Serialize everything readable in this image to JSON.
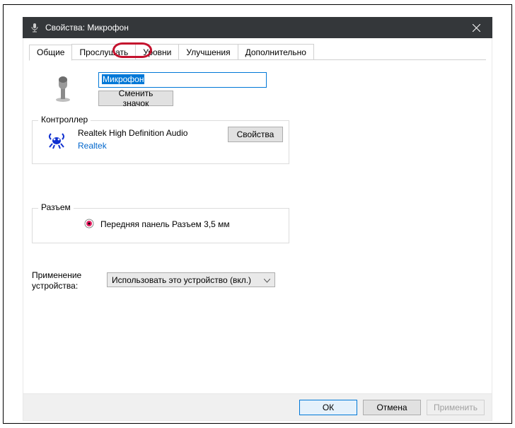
{
  "window": {
    "title": "Свойства: Микрофон"
  },
  "tabs": {
    "general": "Общие",
    "listen": "Прослушать",
    "levels": "Уровни",
    "enhancements": "Улучшения",
    "advanced": "Дополнительно"
  },
  "general": {
    "device_name": "Микрофон",
    "change_icon_btn": "Сменить значок"
  },
  "controller": {
    "legend": "Контроллер",
    "name": "Realtek High Definition Audio",
    "vendor": "Realtek",
    "props_btn": "Свойства"
  },
  "jack": {
    "legend": "Разъем",
    "text": "Передняя панель Разъем 3,5 мм",
    "color": "#e91e63"
  },
  "usage": {
    "label": "Применение устройства:",
    "selected": "Использовать это устройство (вкл.)"
  },
  "footer": {
    "ok": "ОК",
    "cancel": "Отмена",
    "apply": "Применить"
  }
}
